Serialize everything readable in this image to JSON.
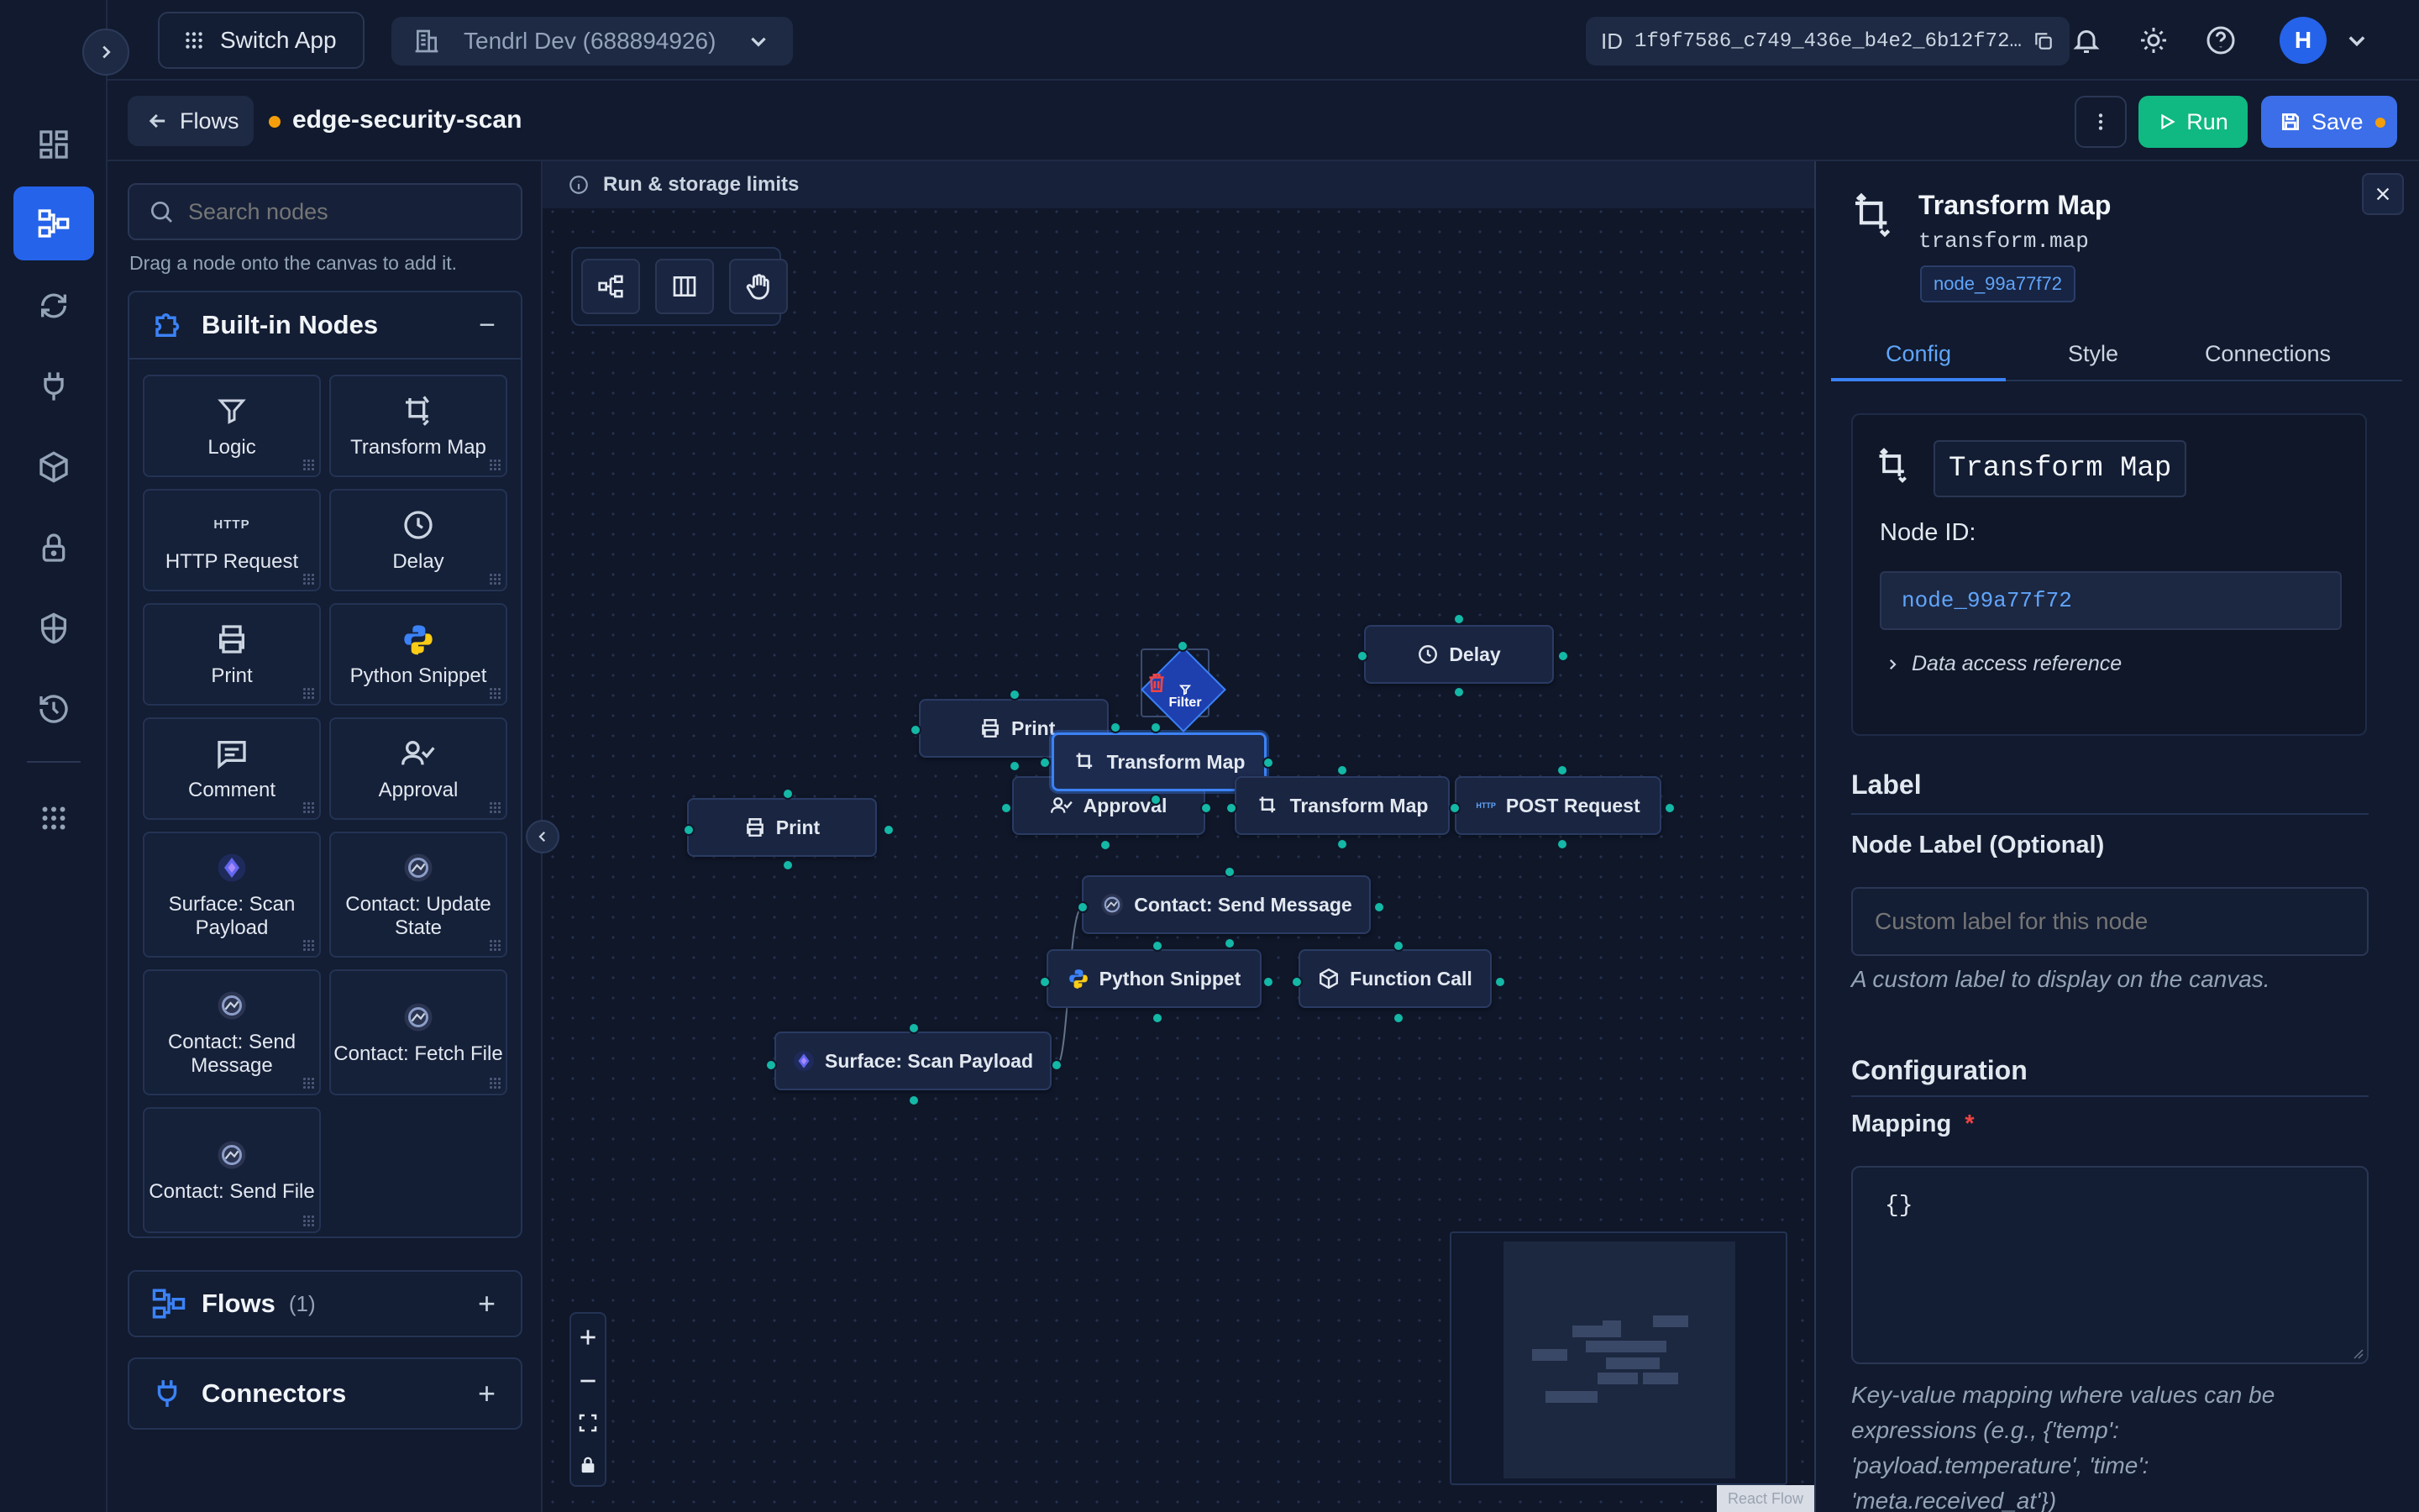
{
  "topbar": {
    "switch_app": "Switch App",
    "workspace": "Tendrl Dev (688894926)",
    "id_label": "ID",
    "id_value": "1f9f7586_c749_436e_b4e2_6b12f72…",
    "avatar_initial": "H"
  },
  "subbar": {
    "back_label": "Flows",
    "flow_name": "edge-security-scan",
    "run_label": "Run",
    "save_label": "Save"
  },
  "palette": {
    "search_placeholder": "Search nodes",
    "hint": "Drag a node onto the canvas to add it.",
    "builtin_title": "Built-in Nodes",
    "collapse_symbol": "−",
    "tiles": [
      {
        "label": "Logic",
        "icon": "filter-icon"
      },
      {
        "label": "Transform Map",
        "icon": "transform-icon"
      },
      {
        "label": "HTTP Request",
        "icon": "http-icon"
      },
      {
        "label": "Delay",
        "icon": "clock-icon"
      },
      {
        "label": "Print",
        "icon": "printer-icon"
      },
      {
        "label": "Python Snippet",
        "icon": "python-icon"
      },
      {
        "label": "Comment",
        "icon": "comment-icon"
      },
      {
        "label": "Approval",
        "icon": "user-check-icon"
      },
      {
        "label": "Surface: Scan Payload",
        "icon": "surface-icon"
      },
      {
        "label": "Contact: Update State",
        "icon": "contact-icon"
      },
      {
        "label": "Contact: Send Message",
        "icon": "contact-icon"
      },
      {
        "label": "Contact: Fetch File",
        "icon": "contact-icon"
      },
      {
        "label": "Contact: Send File",
        "icon": "contact-icon"
      }
    ],
    "flows_title": "Flows",
    "flows_count": "(1)",
    "connectors_title": "Connectors",
    "add_symbol": "+"
  },
  "canvas": {
    "limits_banner": "Run & storage limits",
    "nodes": {
      "delay": "Delay",
      "print_upper": "Print",
      "filter": "Filter",
      "transform_selected": "Transform Map",
      "approval": "Approval",
      "transform_right": "Transform Map",
      "post_request": "POST Request",
      "print_left": "Print",
      "contact_send": "Contact: Send Message",
      "python": "Python Snippet",
      "function_call": "Function Call",
      "surface_scan": "Surface: Scan Payload"
    },
    "attribution": "React Flow"
  },
  "inspector": {
    "title": "Transform Map",
    "type_id": "transform.map",
    "node_badge": "node_99a77f72",
    "tabs": [
      "Config",
      "Style",
      "Connections"
    ],
    "active_tab": "Config",
    "card_title": "Transform Map",
    "node_id_label": "Node ID:",
    "node_id_value": "node_99a77f72",
    "data_access": "Data access reference",
    "label_section": "Label",
    "node_label_field": "Node Label (Optional)",
    "node_label_placeholder": "Custom label for this node",
    "node_label_help": "A custom label to display on the canvas.",
    "config_section": "Configuration",
    "mapping_label": "Mapping",
    "required_mark": "*",
    "mapping_value": "{}",
    "mapping_help": "Key-value mapping where values can be expressions (e.g., {'temp': 'payload.temperature', 'time': 'meta.received_at'})"
  },
  "colors": {
    "accent": "#2563eb",
    "run_green": "#10b981",
    "handle_teal": "#14b8a6",
    "unsaved_dot": "#f59e0b",
    "delete_red": "#ef4444"
  }
}
